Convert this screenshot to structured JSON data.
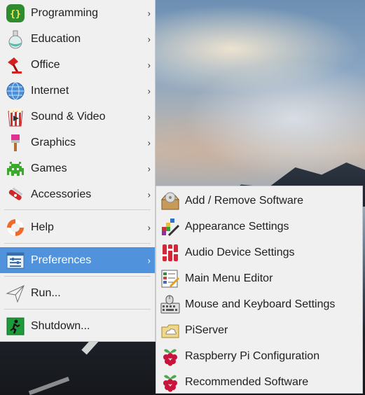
{
  "menu": {
    "items": [
      {
        "label": "Programming",
        "icon": "programming-icon"
      },
      {
        "label": "Education",
        "icon": "education-icon"
      },
      {
        "label": "Office",
        "icon": "office-icon"
      },
      {
        "label": "Internet",
        "icon": "internet-icon"
      },
      {
        "label": "Sound & Video",
        "icon": "sound-video-icon"
      },
      {
        "label": "Graphics",
        "icon": "graphics-icon"
      },
      {
        "label": "Games",
        "icon": "games-icon"
      },
      {
        "label": "Accessories",
        "icon": "accessories-icon"
      },
      {
        "label": "Help",
        "icon": "help-icon"
      },
      {
        "label": "Preferences",
        "icon": "preferences-icon"
      },
      {
        "label": "Run...",
        "icon": "run-icon"
      },
      {
        "label": "Shutdown...",
        "icon": "shutdown-icon"
      }
    ],
    "submenu_arrow": "›",
    "active_color": "#5093dc"
  },
  "submenu": {
    "items": [
      {
        "label": "Add / Remove Software",
        "icon": "add-remove-software-icon"
      },
      {
        "label": "Appearance Settings",
        "icon": "appearance-settings-icon"
      },
      {
        "label": "Audio Device Settings",
        "icon": "audio-device-settings-icon"
      },
      {
        "label": "Main Menu Editor",
        "icon": "main-menu-editor-icon"
      },
      {
        "label": "Mouse and Keyboard Settings",
        "icon": "mouse-keyboard-icon"
      },
      {
        "label": "PiServer",
        "icon": "piserver-icon"
      },
      {
        "label": "Raspberry Pi Configuration",
        "icon": "raspberry-icon"
      },
      {
        "label": "Recommended Software",
        "icon": "raspberry-icon"
      }
    ]
  }
}
